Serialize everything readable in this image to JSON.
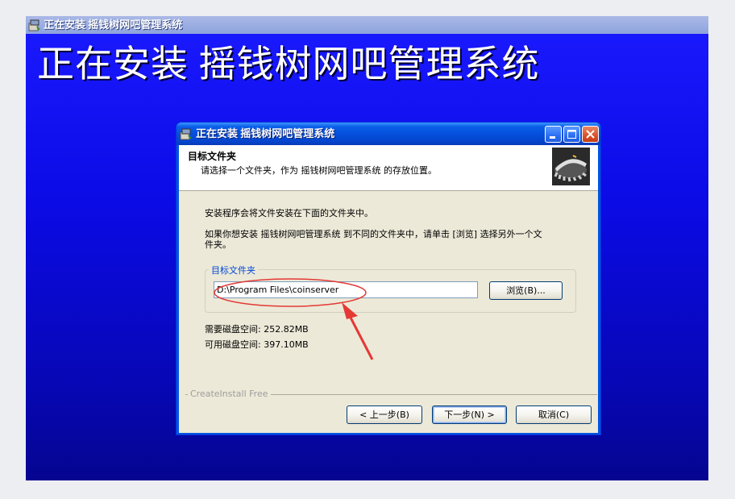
{
  "outer_window": {
    "title": "正在安装  摇钱树网吧管理系统",
    "banner_text": "正在安装 摇钱树网吧管理系统"
  },
  "dialog": {
    "title": "正在安装  摇钱树网吧管理系统",
    "header": {
      "title": "目标文件夹",
      "subtitle": "请选择一个文件夹，作为 摇钱树网吧管理系统 的存放位置。"
    },
    "body": {
      "line1": "安装程序会将文件安装在下面的文件夹中。",
      "line2a": "如果你想安装 摇钱树网吧管理系统 到不同的文件夹中，请单击 [浏览] 选择另外一个文",
      "line2b": "件夹。",
      "group_label": "目标文件夹",
      "path_value": "D:\\Program Files\\coinserver",
      "browse_label": "浏览(B)...",
      "disk_required": "需要磁盘空间: 252.82MB",
      "disk_available": "可用磁盘空间: 397.10MB"
    },
    "branding": "CreateInstall Free",
    "buttons": {
      "back": "< 上一步(B)",
      "next": "下一步(N) >",
      "cancel": "取消(C)"
    }
  },
  "colors": {
    "desktop_blue": "#0b0be6",
    "dialog_title_blue": "#0550dc",
    "dialog_face": "#ece9d8",
    "group_label_blue": "#0046d5",
    "annotation_red": "#e53935"
  }
}
